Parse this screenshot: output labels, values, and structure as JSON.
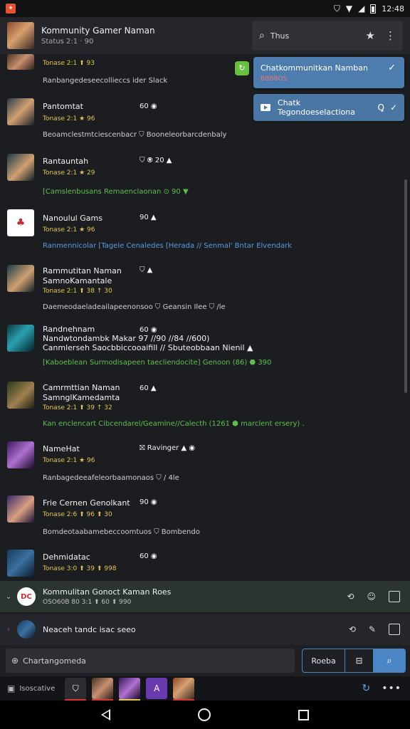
{
  "status_bar": {
    "time": "12:48"
  },
  "header": {
    "title": "Kommunity Gamer Naman",
    "subtitle": "Status 2:1 · 90"
  },
  "search": {
    "query": "Thus"
  },
  "popups": [
    {
      "title": "Chatkommunitkan Namban",
      "sub": "BBBBOS"
    },
    {
      "title": "Chatk Tegondoeselactiona"
    }
  ],
  "rows": [
    {
      "name": "",
      "meta": "Tonase 2:1 ⬆ 93",
      "stat": "",
      "msg": "Ranbangedeseecollieccs ider Slack",
      "msg_color": "white"
    },
    {
      "name": "Pantomtat",
      "meta": "Tonase 2:1 ★ 96",
      "stat": "60 ◉",
      "msg": "Beoamclestmtciescenbacr ⛉ Booneleorbarcdenbaly",
      "msg_color": "white"
    },
    {
      "name": "Rantauntah",
      "meta": "Tonase 2:1 ★ 29",
      "stat": "⛉ ⦿ 20 ▲",
      "msg": "[Camslenbusans Remaenclaonan ⊙ 90 ▼",
      "msg_color": "green"
    },
    {
      "name": "Nanoulul Gams",
      "meta": "Tonase 2:1 ★ 96",
      "stat": "90 ▲",
      "msg": "Ranmennicolar [Tagele Cenaledes [Herada // Senmal' Bntar Elvendark",
      "msg_color": "blue"
    },
    {
      "name": "Rammutitan Naman\nSamnoKamantale",
      "meta": "Tonase 2:1 ⬆ 38 ↑ 30",
      "stat": "⛉ ▲",
      "msg": "Daemeodaeladeailapeenonsoo ⛉ Geansin Ilee ⛉ /le",
      "msg_color": "white"
    },
    {
      "name": "Randnehnam\nNandwtondambk Makar 97 //90 //84 //600)\nCanmlerseh Saocbbiccooaifill // Sbuteobbaan Nienil ▲",
      "meta": "",
      "stat": "60 ◉",
      "msg": "[Kaboeblean Surmodisapeen taecliendocite] Genoon (86) ⬣ 390",
      "msg_color": "green"
    },
    {
      "name": "Camrmttian Naman\nSamnglKamedamta",
      "meta": "Tonase 2:1 ⬆ 39 ↑ 32",
      "stat": "60 ▲",
      "msg": "Kan enclencart Cibcendarel/Geamlne//Calecth (1261 ⬢ marclent ersery) .",
      "msg_color": "green"
    },
    {
      "name": "NameHat",
      "meta": "Tonase 2:1 ★ 96",
      "stat": "⛝ Ravinger ▲ ◉",
      "msg": "Ranbagedeeafeleorbaamonaos ⛉ / 4le",
      "msg_color": "white"
    },
    {
      "name": "Frie Cernen Genolkant",
      "meta": "Tonase 2:6 ⬆ 96 ⬆ 30",
      "stat": "90 ◉",
      "msg": "Bomdeotaabamebeccoomtuos ⛉ Bombendo",
      "msg_color": "white"
    },
    {
      "name": "Dehmidatac",
      "meta": "Tonase 3:0 ⬆ 39 ⬆ 998",
      "stat": "60 ◉",
      "msg": "",
      "msg_color": "white"
    }
  ],
  "conversations": [
    {
      "title": "Kommulitan Gonoct Kaman Roes",
      "sub": "OSO60B 80 3:1 ⬆ 60 ⬆ 990"
    },
    {
      "title": "Neaceh tandc isac seeo",
      "sub": ""
    }
  ],
  "composer": {
    "placeholder": "Chartangomeda",
    "seg_label": "Roeba"
  },
  "taskbar": {
    "label": "Isoscative"
  },
  "colors": {
    "accent": "#4a86c5",
    "green": "#5cc14b",
    "gold": "#e3c64a",
    "popup": "#4d7caf"
  }
}
